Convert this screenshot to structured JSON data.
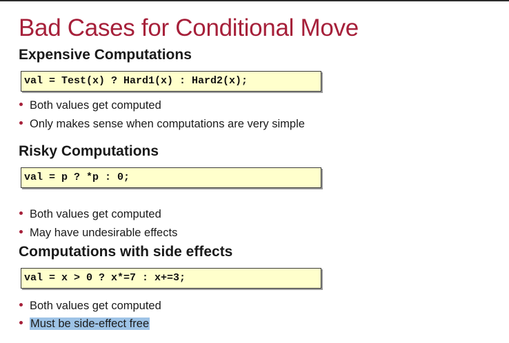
{
  "slide": {
    "title": "Bad Cases for Conditional Move",
    "sections": [
      {
        "heading": "Expensive Computations",
        "code": "val = Test(x) ? Hard1(x) : Hard2(x);",
        "bullets": [
          "Both values get computed",
          "Only makes sense when computations are very simple"
        ]
      },
      {
        "heading": "Risky Computations",
        "code": "val = p ? *p : 0;",
        "bullets": [
          "Both values get computed",
          "May have undesirable effects"
        ]
      },
      {
        "heading": "Computations with side effects",
        "code": "val = x > 0 ? x*=7 : x+=3;",
        "bullets": [
          "Both values get computed",
          "Must be side-effect free"
        ]
      }
    ],
    "accent_color": "#a6203a",
    "code_background": "#ffffcc",
    "selection_color": "#9ec3e6"
  }
}
